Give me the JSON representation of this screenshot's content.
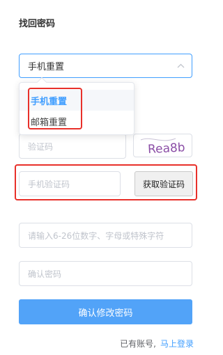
{
  "page": {
    "title": "找回密码"
  },
  "reset_type": {
    "selected": "手机重置",
    "options": [
      "手机重置",
      "邮箱重置"
    ]
  },
  "captcha": {
    "placeholder": "验证码",
    "image_text": "Rea8b"
  },
  "sms": {
    "placeholder": "手机验证码",
    "button_label": "获取验证码"
  },
  "password": {
    "placeholder": "请输入6-26位数字、字母或特殊字符"
  },
  "confirm_password": {
    "placeholder": "确认密码"
  },
  "submit": {
    "label": "确认修改密码"
  },
  "footer": {
    "prompt": "已有账号,",
    "login_link": "马上登录"
  },
  "colors": {
    "accent": "#409eff",
    "button": "#52a3f8",
    "highlight": "#e8302a"
  }
}
